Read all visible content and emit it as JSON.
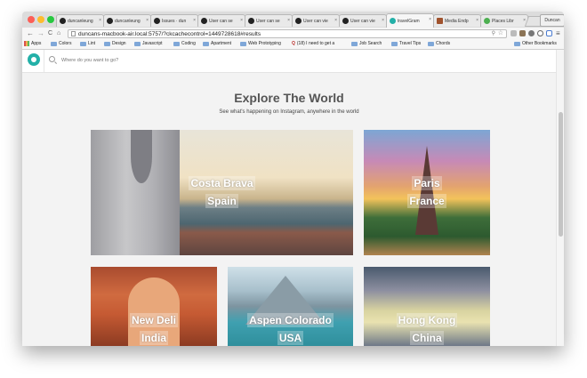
{
  "browser": {
    "tabs": [
      {
        "label": "duncanleung",
        "active": false
      },
      {
        "label": "duncanleung",
        "active": false
      },
      {
        "label": "Issues · dun",
        "active": false
      },
      {
        "label": "User can se",
        "active": false
      },
      {
        "label": "User can se",
        "active": false
      },
      {
        "label": "User can vie",
        "active": false
      },
      {
        "label": "User can vie",
        "active": false
      },
      {
        "label": "travelGram",
        "active": true
      },
      {
        "label": "Media Endp",
        "active": false
      },
      {
        "label": "Places Libr",
        "active": false
      }
    ],
    "profile_label": "Duncan",
    "url": "duncans-macbook-air.local:5757/?ckcachecontrol=1449728618#results",
    "bookmarks": [
      "Apps",
      "Colors",
      "Lint",
      "Design",
      "Javascript",
      "Coding",
      "Apartment",
      "Web Prototyping",
      "(18) I need to get a",
      "Job Search",
      "Travel Tips",
      "Chords"
    ],
    "other_bookmarks": "Other Bookmarks"
  },
  "app": {
    "search_placeholder": "Where do you want to go?",
    "heading": "Explore The World",
    "subheading": "See what's happening on Instagram, anywhere in the world",
    "cards": [
      {
        "city": "Costa Brava",
        "country": "Spain"
      },
      {
        "city": "Paris",
        "country": "France"
      },
      {
        "city": "New Deli",
        "country": "India"
      },
      {
        "city": "Aspen Colorado",
        "country": "USA"
      },
      {
        "city": "Hong Kong",
        "country": "China"
      }
    ]
  },
  "colors": {
    "brand": "#23b0a8",
    "heading": "#555555"
  }
}
